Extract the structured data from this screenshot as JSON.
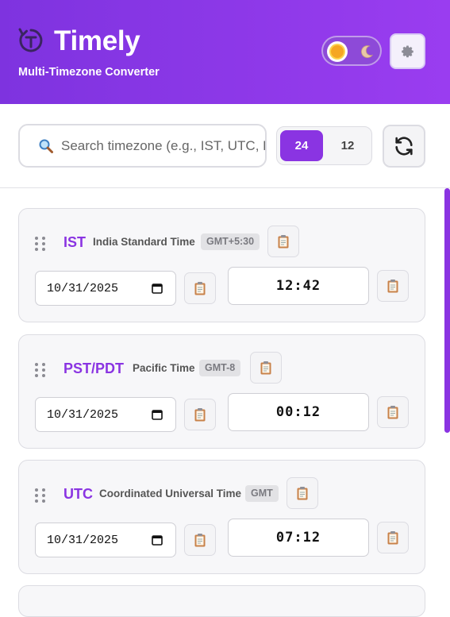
{
  "app": {
    "title": "Timely",
    "subtitle": "Multi-Timezone Converter"
  },
  "theme_toggle": {
    "state": "light",
    "icons": [
      "sun-icon",
      "moon-icon"
    ]
  },
  "settings": {
    "icon": "gear-icon"
  },
  "search": {
    "placeholder": "Search timezone (e.g., IST, UTC, PST)",
    "value": ""
  },
  "format": {
    "options": [
      "24",
      "12"
    ],
    "selected": "24"
  },
  "refresh": {
    "icon": "refresh-icon"
  },
  "colors": {
    "accent": "#8a34e2",
    "header_gradient": [
      "#7e33df",
      "#9a3df0"
    ]
  },
  "timezones": [
    {
      "abbr": "IST",
      "name": "India Standard Time",
      "offset": "GMT+5:30",
      "date": "10/31/2025",
      "time": "12:42"
    },
    {
      "abbr": "PST/PDT",
      "name": "Pacific Time",
      "offset": "GMT-8",
      "date": "10/31/2025",
      "time": "00:12"
    },
    {
      "abbr": "UTC",
      "name": "Coordinated Universal Time",
      "offset": "GMT",
      "date": "10/31/2025",
      "time": "07:12"
    }
  ]
}
